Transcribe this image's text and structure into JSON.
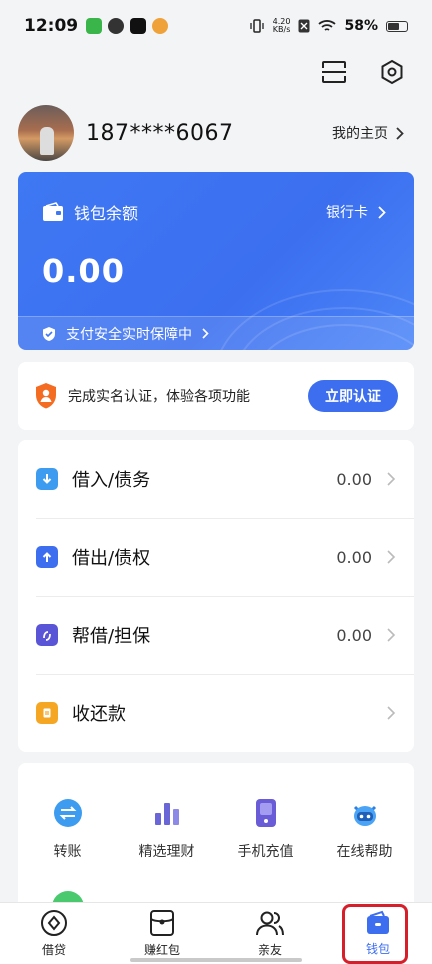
{
  "status_bar": {
    "time": "12:09",
    "net_speed": "4.20",
    "net_unit": "KB/s",
    "battery": "58%"
  },
  "profile": {
    "phone": "187****6067",
    "homepage_label": "我的主页"
  },
  "wallet": {
    "title": "钱包余额",
    "bank_card": "银行卡",
    "balance": "0.00",
    "security": "支付安全实时保障中",
    "accent": "#3d6ef0"
  },
  "verification": {
    "text": "完成实名认证，体验各项功能",
    "button": "立即认证"
  },
  "ledger": {
    "items": [
      {
        "label": "借入/债务",
        "value": "0.00",
        "icon": "arrow-down-icon",
        "color": "#3d9cf0"
      },
      {
        "label": "借出/债权",
        "value": "0.00",
        "icon": "arrow-up-icon",
        "color": "#3d6ef0"
      },
      {
        "label": "帮借/担保",
        "value": "0.00",
        "icon": "guarantee-icon",
        "color": "#5a55d6"
      },
      {
        "label": "收还款",
        "value": "",
        "icon": "receipt-icon",
        "color": "#f5a623"
      }
    ]
  },
  "services": {
    "items": [
      {
        "label": "转账",
        "icon": "transfer-icon"
      },
      {
        "label": "精选理财",
        "icon": "bar-chart-icon"
      },
      {
        "label": "手机充值",
        "icon": "phone-topup-icon"
      },
      {
        "label": "在线帮助",
        "icon": "help-robot-icon"
      }
    ]
  },
  "tabbar": {
    "tabs": [
      {
        "label": "借贷",
        "icon": "loan-icon"
      },
      {
        "label": "赚红包",
        "icon": "red-packet-icon"
      },
      {
        "label": "亲友",
        "icon": "friends-icon"
      },
      {
        "label": "钱包",
        "icon": "wallet-icon",
        "active": true
      }
    ]
  }
}
